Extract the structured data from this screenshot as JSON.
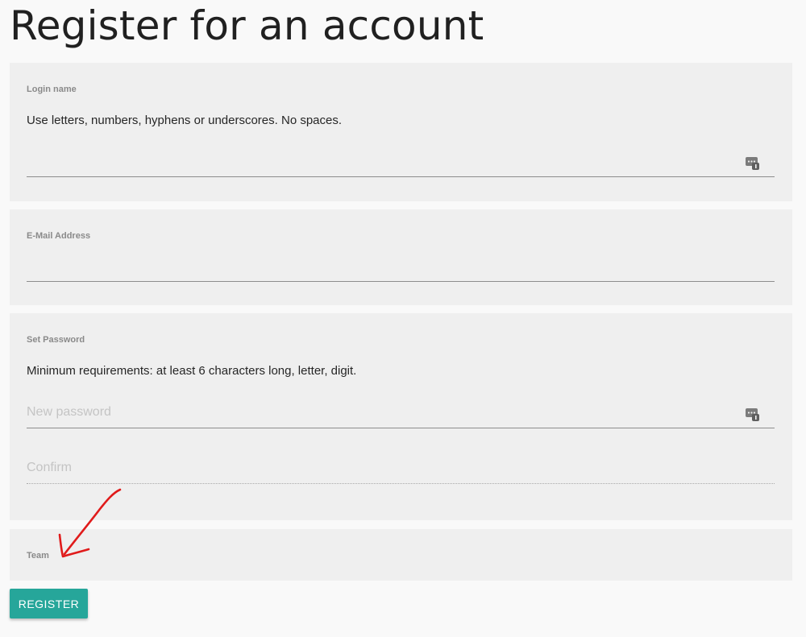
{
  "page": {
    "title": "Register for an account"
  },
  "login": {
    "label": "Login name",
    "hint": "Use letters, numbers, hyphens or underscores. No spaces.",
    "value": "",
    "icon": "password-manager-key-icon"
  },
  "email": {
    "label": "E-Mail Address",
    "value": ""
  },
  "password": {
    "label": "Set Password",
    "hint": "Minimum requirements: at least 6 characters long, letter, digit.",
    "new_placeholder": "New password",
    "confirm_placeholder": "Confirm",
    "icon": "password-manager-key-icon"
  },
  "team": {
    "label": "Team"
  },
  "actions": {
    "register_label": "REGISTER"
  },
  "colors": {
    "accent": "#26a69a",
    "card_background": "#efefef",
    "page_background": "#f9f9f9",
    "annotation": "#e01b1b"
  }
}
